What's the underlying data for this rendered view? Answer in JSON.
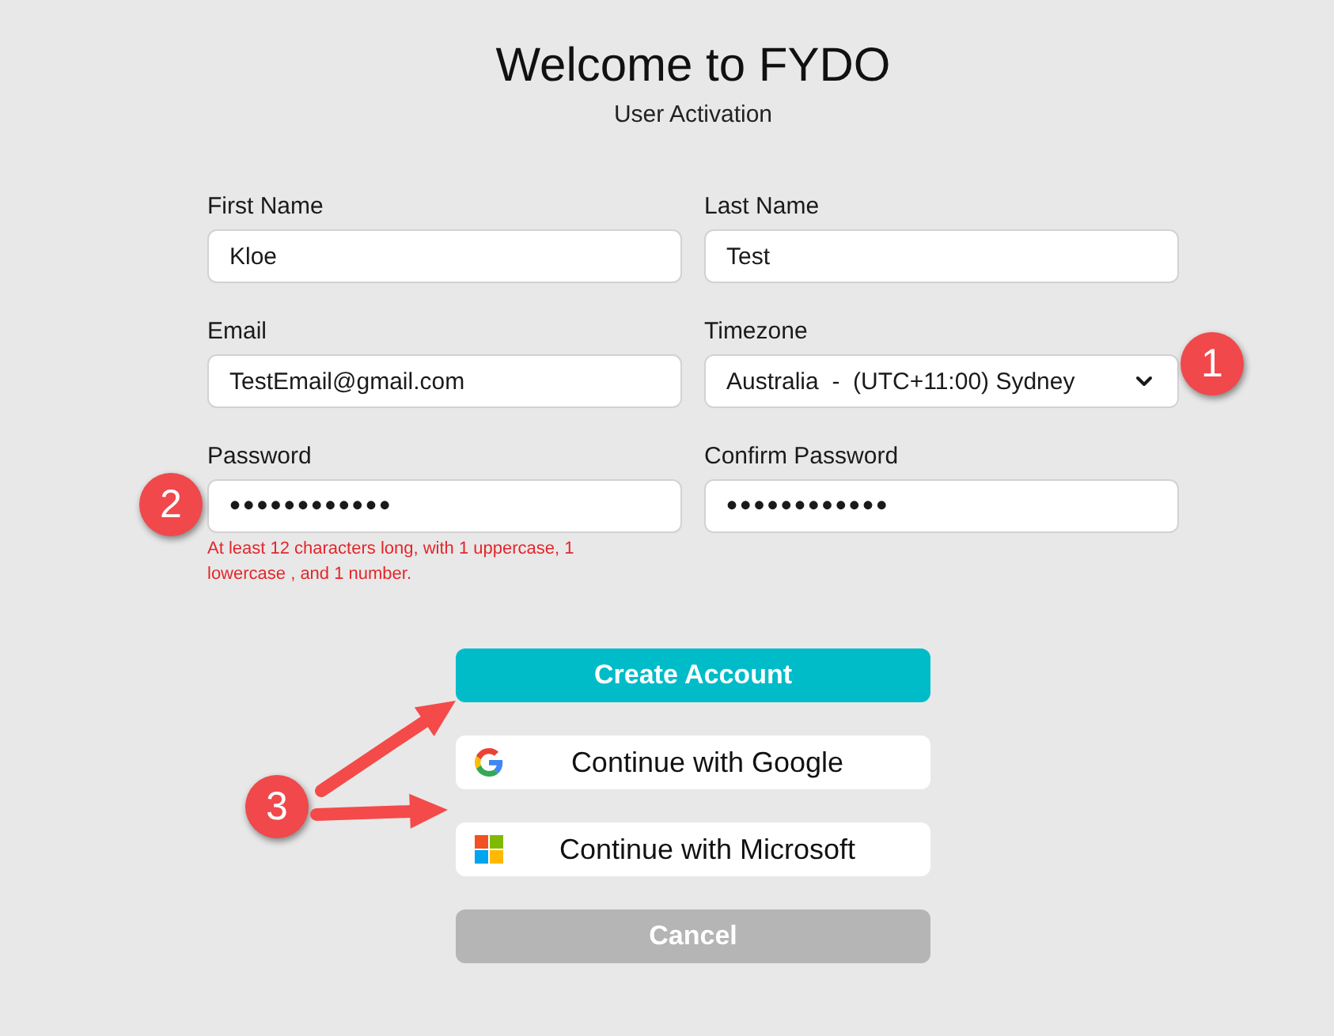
{
  "header": {
    "title": "Welcome to FYDO",
    "subtitle": "User Activation"
  },
  "fields": [
    {
      "label": "First Name",
      "kind": "text",
      "value": "Kloe"
    },
    {
      "label": "Last Name",
      "kind": "text",
      "value": "Test"
    },
    {
      "label": "Email",
      "kind": "text",
      "value": "TestEmail@gmail.com"
    },
    {
      "label": "Timezone",
      "kind": "select",
      "value": "Australia  -  (UTC+11:00) Sydney"
    },
    {
      "label": "Password",
      "kind": "password",
      "value": "••••••••••••",
      "hint": "At least 12 characters long, with 1 uppercase, 1 lowercase , and 1 number."
    },
    {
      "label": "Confirm Password",
      "kind": "password",
      "value": "••••••••••••"
    }
  ],
  "buttons": [
    {
      "label": "Create Account",
      "kind": "primary",
      "disabled": false
    },
    {
      "label": "Continue with Google",
      "kind": "google",
      "disabled": false
    },
    {
      "label": "Continue with Microsoft",
      "kind": "microsoft",
      "disabled": false
    },
    {
      "label": "Cancel",
      "kind": "plain",
      "disabled": true
    }
  ],
  "annotations": [
    {
      "number": "1"
    },
    {
      "number": "2"
    },
    {
      "number": "3"
    }
  ]
}
